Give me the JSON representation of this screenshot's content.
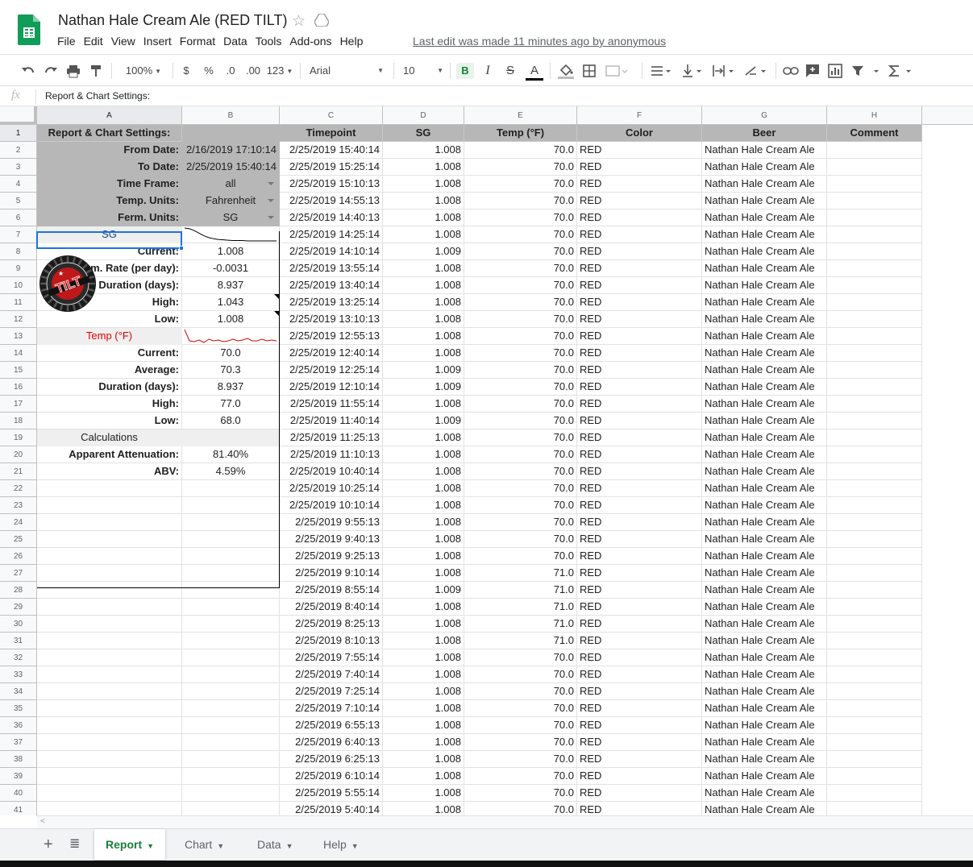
{
  "doc": {
    "title": "Nathan Hale Cream Ale (RED TILT)",
    "last_edit": "Last edit was made 11 minutes ago by anonymous"
  },
  "menu": [
    "File",
    "Edit",
    "View",
    "Insert",
    "Format",
    "Data",
    "Tools",
    "Add-ons",
    "Help"
  ],
  "toolbar": {
    "zoom": "100%",
    "currency": "$",
    "percent": "%",
    "dec_less": ".0",
    "dec_more": ".00",
    "format_more": "123",
    "font": "Arial",
    "font_size": "10",
    "bold": "B",
    "italic": "I",
    "strike": "S",
    "text_color": "A"
  },
  "formula_bar": {
    "fx": "fx",
    "value": "Report & Chart Settings:"
  },
  "columns": [
    "A",
    "B",
    "C",
    "D",
    "E",
    "F",
    "G",
    "H"
  ],
  "panel": {
    "title": "Report & Chart Settings:",
    "from_label": "From Date:",
    "from_value": "2/16/2019 17:10:14",
    "to_label": "To Date:",
    "to_value": "2/25/2019 15:40:14",
    "timeframe_label": "Time Frame:",
    "timeframe_value": "all",
    "temp_units_label": "Temp. Units:",
    "temp_units_value": "Fahrenheit",
    "ferm_units_label": "Ferm. Units:",
    "ferm_units_value": "SG",
    "badge_text": "TILT",
    "sg_section": "SG",
    "sg_current_label": "Current:",
    "sg_current": "1.008",
    "sg_rate_label": "Ferm. Rate (per day):",
    "sg_rate": "-0.0031",
    "sg_duration_label": "Duration (days):",
    "sg_duration": "8.937",
    "sg_high_label": "High:",
    "sg_high": "1.043",
    "sg_low_label": "Low:",
    "sg_low": "1.008",
    "temp_section": "Temp (°F)",
    "temp_current_label": "Current:",
    "temp_current": "70.0",
    "temp_avg_label": "Average:",
    "temp_avg": "70.3",
    "temp_duration_label": "Duration (days):",
    "temp_duration": "8.937",
    "temp_high_label": "High:",
    "temp_high": "77.0",
    "temp_low_label": "Low:",
    "temp_low": "68.0",
    "calc_section": "Calculations",
    "atten_label": "Apparent Attenuation:",
    "atten": "81.40%",
    "abv_label": "ABV:",
    "abv": "4.59%"
  },
  "sparklines": {
    "sg": [
      1.043,
      1.041,
      1.036,
      1.029,
      1.022,
      1.017,
      1.014,
      1.012,
      1.011,
      1.01,
      1.009,
      1.009,
      1.009,
      1.008,
      1.008,
      1.008,
      1.008,
      1.008,
      1.008,
      1.008
    ],
    "temp": [
      77.0,
      70.0,
      69.5,
      70.5,
      69.0,
      71.0,
      70.0,
      70.5,
      69.5,
      70.0,
      71.0,
      70.0,
      70.5,
      71.5,
      70.0,
      70.0,
      71.0,
      70.0,
      70.5,
      70.0
    ]
  },
  "table": {
    "headers": [
      "Timepoint",
      "SG",
      "Temp (°F)",
      "Color",
      "Beer",
      "Comment"
    ],
    "rows": [
      [
        "2/25/2019 15:40:14",
        "1.008",
        "70.0",
        "RED",
        "Nathan Hale Cream Ale"
      ],
      [
        "2/25/2019 15:25:14",
        "1.008",
        "70.0",
        "RED",
        "Nathan Hale Cream Ale"
      ],
      [
        "2/25/2019 15:10:13",
        "1.008",
        "70.0",
        "RED",
        "Nathan Hale Cream Ale"
      ],
      [
        "2/25/2019 14:55:13",
        "1.008",
        "70.0",
        "RED",
        "Nathan Hale Cream Ale"
      ],
      [
        "2/25/2019 14:40:13",
        "1.008",
        "70.0",
        "RED",
        "Nathan Hale Cream Ale"
      ],
      [
        "2/25/2019 14:25:14",
        "1.008",
        "70.0",
        "RED",
        "Nathan Hale Cream Ale"
      ],
      [
        "2/25/2019 14:10:14",
        "1.009",
        "70.0",
        "RED",
        "Nathan Hale Cream Ale"
      ],
      [
        "2/25/2019 13:55:14",
        "1.008",
        "70.0",
        "RED",
        "Nathan Hale Cream Ale"
      ],
      [
        "2/25/2019 13:40:14",
        "1.008",
        "70.0",
        "RED",
        "Nathan Hale Cream Ale"
      ],
      [
        "2/25/2019 13:25:14",
        "1.008",
        "70.0",
        "RED",
        "Nathan Hale Cream Ale"
      ],
      [
        "2/25/2019 13:10:13",
        "1.008",
        "70.0",
        "RED",
        "Nathan Hale Cream Ale"
      ],
      [
        "2/25/2019 12:55:13",
        "1.008",
        "70.0",
        "RED",
        "Nathan Hale Cream Ale"
      ],
      [
        "2/25/2019 12:40:14",
        "1.008",
        "70.0",
        "RED",
        "Nathan Hale Cream Ale"
      ],
      [
        "2/25/2019 12:25:14",
        "1.009",
        "70.0",
        "RED",
        "Nathan Hale Cream Ale"
      ],
      [
        "2/25/2019 12:10:14",
        "1.009",
        "70.0",
        "RED",
        "Nathan Hale Cream Ale"
      ],
      [
        "2/25/2019 11:55:14",
        "1.008",
        "70.0",
        "RED",
        "Nathan Hale Cream Ale"
      ],
      [
        "2/25/2019 11:40:14",
        "1.009",
        "70.0",
        "RED",
        "Nathan Hale Cream Ale"
      ],
      [
        "2/25/2019 11:25:13",
        "1.008",
        "70.0",
        "RED",
        "Nathan Hale Cream Ale"
      ],
      [
        "2/25/2019 11:10:13",
        "1.008",
        "70.0",
        "RED",
        "Nathan Hale Cream Ale"
      ],
      [
        "2/25/2019 10:40:14",
        "1.008",
        "70.0",
        "RED",
        "Nathan Hale Cream Ale"
      ],
      [
        "2/25/2019 10:25:14",
        "1.008",
        "70.0",
        "RED",
        "Nathan Hale Cream Ale"
      ],
      [
        "2/25/2019 10:10:14",
        "1.008",
        "70.0",
        "RED",
        "Nathan Hale Cream Ale"
      ],
      [
        "2/25/2019 9:55:13",
        "1.008",
        "70.0",
        "RED",
        "Nathan Hale Cream Ale"
      ],
      [
        "2/25/2019 9:40:13",
        "1.008",
        "70.0",
        "RED",
        "Nathan Hale Cream Ale"
      ],
      [
        "2/25/2019 9:25:13",
        "1.008",
        "70.0",
        "RED",
        "Nathan Hale Cream Ale"
      ],
      [
        "2/25/2019 9:10:14",
        "1.008",
        "71.0",
        "RED",
        "Nathan Hale Cream Ale"
      ],
      [
        "2/25/2019 8:55:14",
        "1.009",
        "71.0",
        "RED",
        "Nathan Hale Cream Ale"
      ],
      [
        "2/25/2019 8:40:14",
        "1.008",
        "71.0",
        "RED",
        "Nathan Hale Cream Ale"
      ],
      [
        "2/25/2019 8:25:13",
        "1.008",
        "71.0",
        "RED",
        "Nathan Hale Cream Ale"
      ],
      [
        "2/25/2019 8:10:13",
        "1.008",
        "71.0",
        "RED",
        "Nathan Hale Cream Ale"
      ],
      [
        "2/25/2019 7:55:14",
        "1.008",
        "70.0",
        "RED",
        "Nathan Hale Cream Ale"
      ],
      [
        "2/25/2019 7:40:14",
        "1.008",
        "70.0",
        "RED",
        "Nathan Hale Cream Ale"
      ],
      [
        "2/25/2019 7:25:14",
        "1.008",
        "70.0",
        "RED",
        "Nathan Hale Cream Ale"
      ],
      [
        "2/25/2019 7:10:14",
        "1.008",
        "70.0",
        "RED",
        "Nathan Hale Cream Ale"
      ],
      [
        "2/25/2019 6:55:13",
        "1.008",
        "70.0",
        "RED",
        "Nathan Hale Cream Ale"
      ],
      [
        "2/25/2019 6:40:13",
        "1.008",
        "70.0",
        "RED",
        "Nathan Hale Cream Ale"
      ],
      [
        "2/25/2019 6:25:13",
        "1.008",
        "70.0",
        "RED",
        "Nathan Hale Cream Ale"
      ],
      [
        "2/25/2019 6:10:14",
        "1.008",
        "70.0",
        "RED",
        "Nathan Hale Cream Ale"
      ],
      [
        "2/25/2019 5:55:14",
        "1.008",
        "70.0",
        "RED",
        "Nathan Hale Cream Ale"
      ],
      [
        "2/25/2019 5:40:14",
        "1.008",
        "70.0",
        "RED",
        "Nathan Hale Cream Ale"
      ]
    ]
  },
  "sheet_tabs": [
    "Report",
    "Chart",
    "Data",
    "Help"
  ],
  "colors": {
    "brand_green": "#188038",
    "panel_gray": "#b7b7b7",
    "section_gray": "#efefef",
    "sg_blue": "#1c4587",
    "temp_red": "#e00000",
    "selection_blue": "#1a73e8"
  }
}
